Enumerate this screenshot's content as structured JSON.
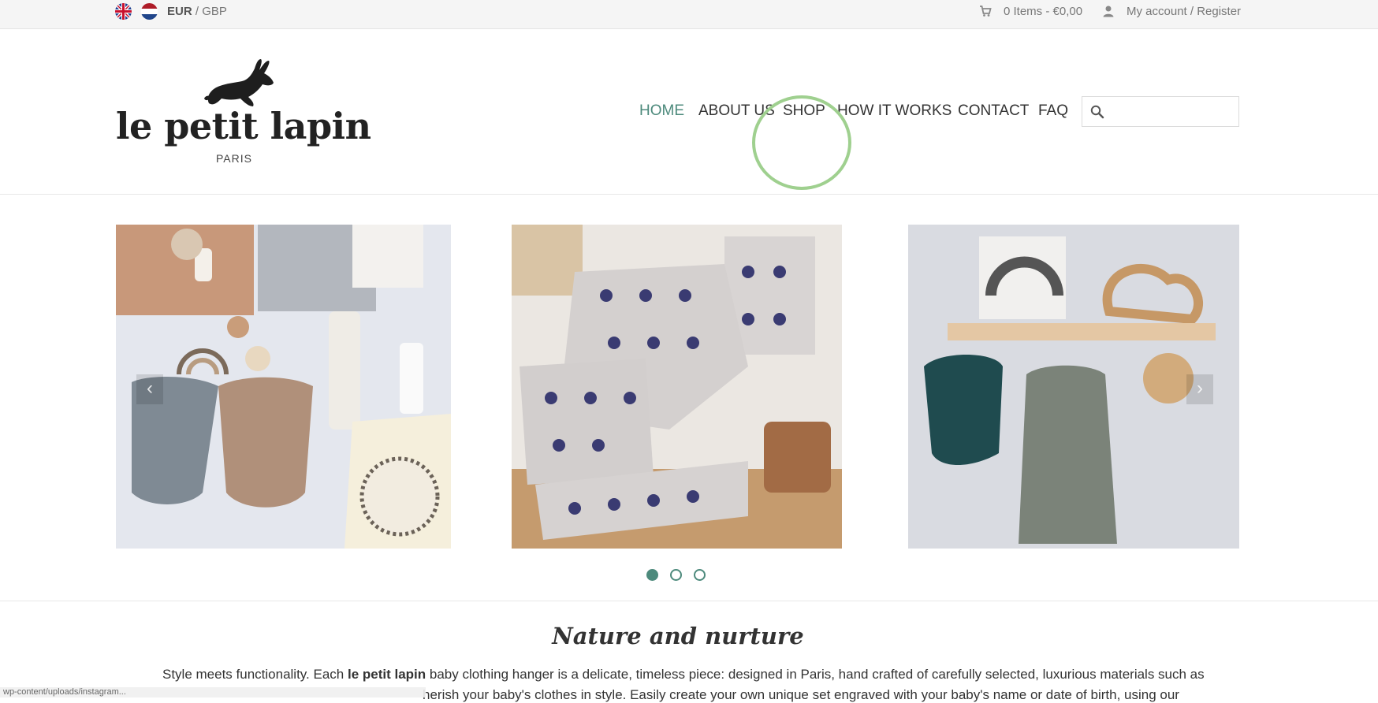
{
  "topbar": {
    "currency_active": "EUR",
    "currency_sep": " / ",
    "currency_other": "GBP",
    "cart": "0 Items - €0,00",
    "account": "My account / Register"
  },
  "logo": {
    "name": "le petit lapin",
    "city": "PARIS"
  },
  "nav": {
    "items": [
      "HOME",
      "ABOUT US",
      "SHOP",
      "HOW IT WORKS",
      "CONTACT",
      "FAQ"
    ]
  },
  "colors": {
    "accent": "#4d8a7c",
    "highlight_circle": "#9fd08f"
  },
  "slider": {
    "prev_label": "‹",
    "next_label": "›",
    "dots": 3,
    "active_dot": 1
  },
  "intro": {
    "title": "Nature and nurture",
    "line1_pre": "Style meets functionality. Each ",
    "line1_bold": "le petit lapin",
    "line1_post": " baby clothing hanger is a delicate, timeless piece: designed in Paris, hand crafted of carefully selected, luxurious materials such as",
    "line2": "herish your baby's clothes in style. Easily create your own unique set engraved with your baby's name or date of birth, using our"
  },
  "status_bar": "wp-content/uploads/instagram..."
}
